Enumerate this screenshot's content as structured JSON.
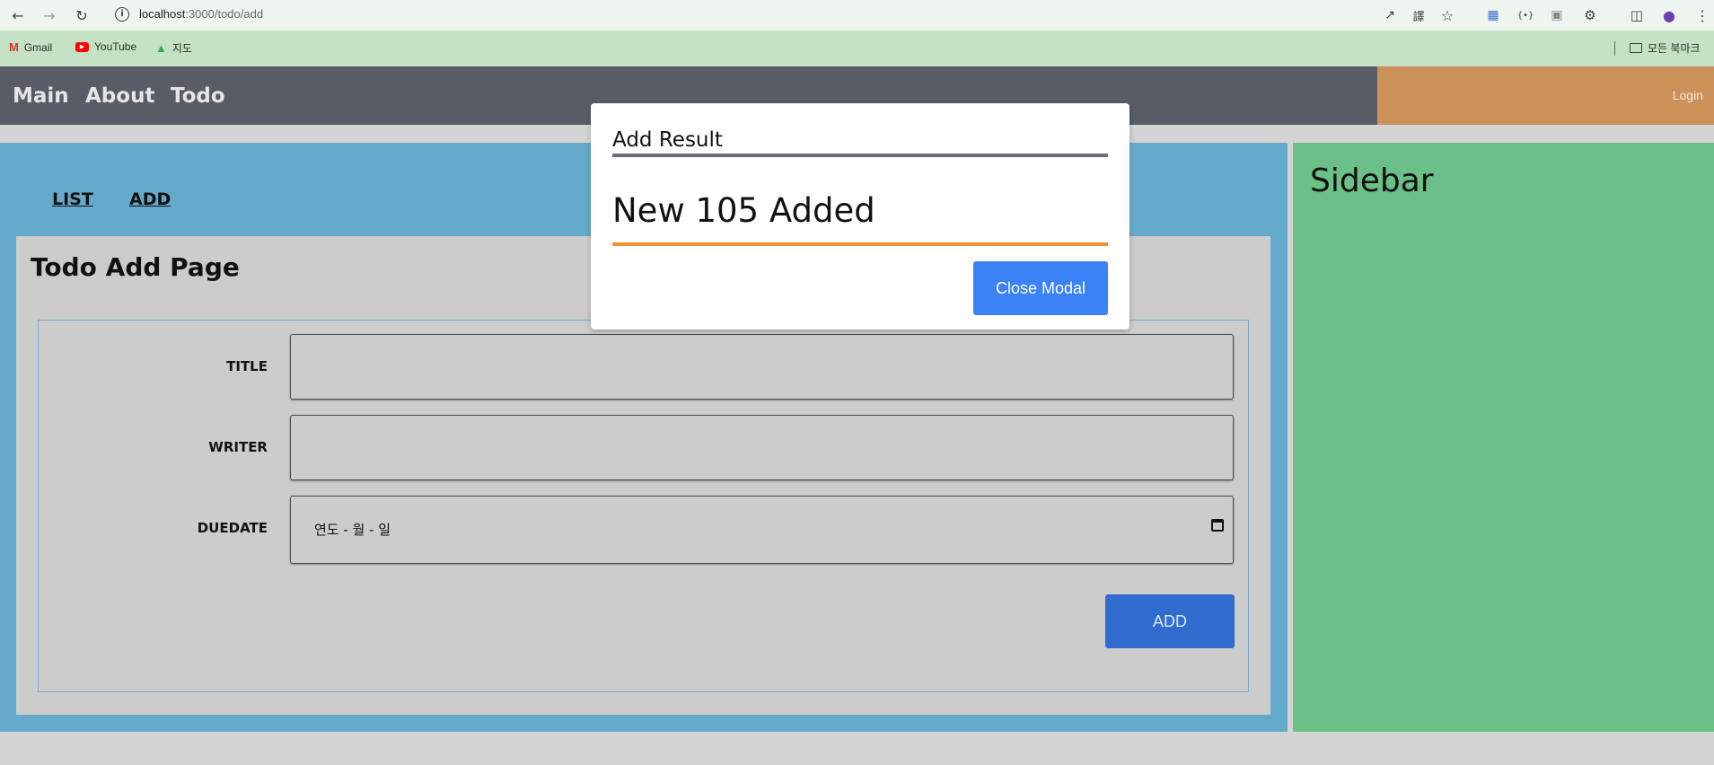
{
  "browser": {
    "url_host": "localhost",
    "url_path": ":3000/todo/add",
    "bookmarks": [
      {
        "label": "Gmail",
        "icon": "gmail-icon"
      },
      {
        "label": "YouTube",
        "icon": "youtube-icon"
      },
      {
        "label": "지도",
        "icon": "maps-icon"
      }
    ],
    "all_bookmarks_label": "모든 북마크"
  },
  "nav": {
    "links": [
      "Main",
      "About",
      "Todo"
    ],
    "login_label": "Login"
  },
  "subnav": {
    "list": "LIST",
    "add": "ADD"
  },
  "page": {
    "title": "Todo Add Page",
    "fields": [
      {
        "label": "TITLE",
        "value": ""
      },
      {
        "label": "WRITER",
        "value": ""
      },
      {
        "label": "DUEDATE",
        "value": "",
        "placeholder": "연도 - 월 - 일"
      }
    ],
    "add_button": "ADD"
  },
  "sidebar": {
    "title": "Sidebar"
  },
  "modal": {
    "title": "Add Result",
    "message": "New 105 Added",
    "close_button": "Close Modal"
  },
  "colors": {
    "topnav": "#575c67",
    "login_bar": "#cb9159",
    "main_bg": "#66aacb",
    "page_bg": "#cccccc",
    "sidebar_bg": "#6bc088",
    "modal_title_rule": "#6a6f7b",
    "modal_msg_rule": "#f28f2c",
    "close_button": "#3b82f6",
    "add_button": "#2f6ccd"
  }
}
